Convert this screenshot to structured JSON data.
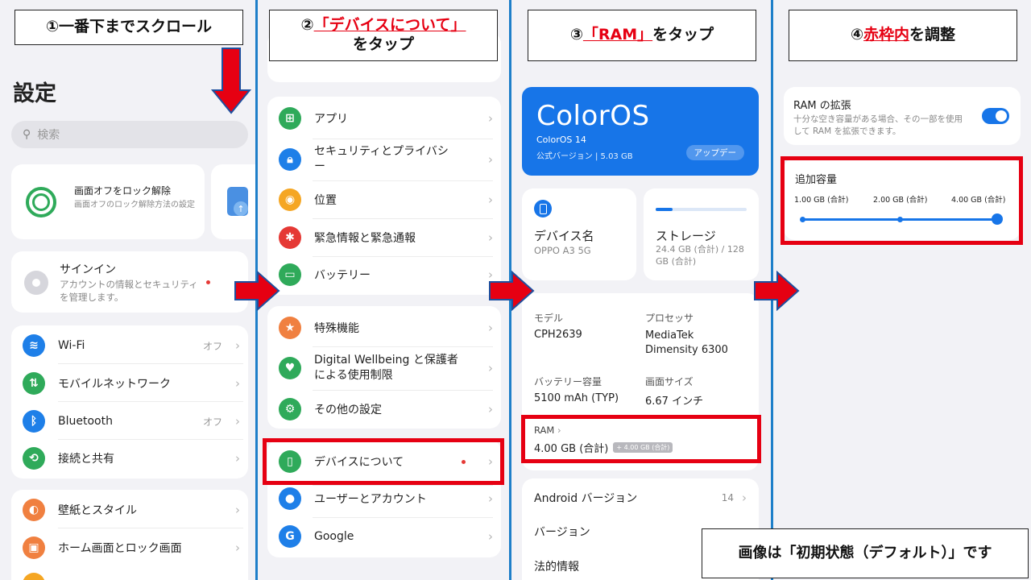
{
  "colors": {
    "red": "#e60012",
    "blue": "#1e7fc9",
    "oppo_blue": "#1775e8"
  },
  "callouts": {
    "step1": "①一番下までスクロール",
    "step2_num": "②",
    "step2_red": "「デバイスについて」",
    "step2_suffix": "をタップ",
    "step3_num": "③",
    "step3_red": "「RAM」",
    "step3_suffix": "をタップ",
    "step4_num": "④",
    "step4_red": "赤枠内",
    "step4_suffix": "を調整",
    "note": "画像は「初期状態（デフォルト）」です"
  },
  "panel1": {
    "title": "設定",
    "search_placeholder": "検索",
    "unlock_title": "画面オフをロック解除",
    "unlock_desc": "画面オフのロック解除方法の設定",
    "signin_title": "サインイン",
    "signin_desc": "アカウントの情報とセキュリティを管理します。",
    "items": [
      {
        "label": "Wi-Fi",
        "value": "オフ",
        "icon": "wifi-icon",
        "color": "#1e7fe8"
      },
      {
        "label": "モバイルネットワーク",
        "value": "",
        "icon": "mobile-network-icon",
        "color": "#2faa5a"
      },
      {
        "label": "Bluetooth",
        "value": "オフ",
        "icon": "bluetooth-icon",
        "color": "#1e7fe8"
      },
      {
        "label": "接続と共有",
        "value": "",
        "icon": "share-icon",
        "color": "#2faa5a"
      }
    ],
    "items2": [
      {
        "label": "壁紙とスタイル",
        "icon": "wallpaper-icon",
        "color": "#f08040"
      },
      {
        "label": "ホーム画面とロック画面",
        "icon": "home-screen-icon",
        "color": "#f08040"
      }
    ]
  },
  "panel2": {
    "items": [
      {
        "label": "アプリ",
        "icon": "apps-icon",
        "color": "#2faa5a"
      },
      {
        "label": "セキュリティとプライバシー",
        "icon": "security-icon",
        "color": "#1e7fe8"
      },
      {
        "label": "位置",
        "icon": "location-icon",
        "color": "#f5a623"
      },
      {
        "label": "緊急情報と緊急通報",
        "icon": "emergency-icon",
        "color": "#e53935"
      },
      {
        "label": "バッテリー",
        "icon": "battery-icon",
        "color": "#2faa5a"
      }
    ],
    "items2": [
      {
        "label": "特殊機能",
        "icon": "special-features-icon",
        "color": "#f08040"
      },
      {
        "label": "Digital Wellbeing と保護者による使用制限",
        "icon": "wellbeing-icon",
        "color": "#2faa5a"
      },
      {
        "label": "その他の設定",
        "icon": "other-settings-icon",
        "color": "#2faa5a"
      }
    ],
    "items3": [
      {
        "label": "デバイスについて",
        "icon": "device-icon",
        "color": "#2faa5a"
      },
      {
        "label": "ユーザーとアカウント",
        "icon": "user-icon",
        "color": "#1e7fe8"
      },
      {
        "label": "Google",
        "icon": "google-icon",
        "color": "#1e7fe8"
      }
    ]
  },
  "panel3": {
    "os_logo": "ColorOS",
    "os_version": "ColorOS 14",
    "os_official": "公式バージョン | 5.03 GB",
    "update_btn": "アップデー",
    "device_name_label": "デバイス名",
    "device_name_value": "OPPO A3 5G",
    "storage_label": "ストレージ",
    "storage_value": "24.4 GB (合計) / 128 GB (合計)",
    "storage_used_fraction": 0.19,
    "model_label": "モデル",
    "model_value": "CPH2639",
    "cpu_label": "プロセッサ",
    "cpu_value": "MediaTek Dimensity 6300",
    "battery_label": "バッテリー容量",
    "battery_value": "5100 mAh (TYP)",
    "screen_label": "画面サイズ",
    "screen_value": "6.67 インチ",
    "ram_label": "RAM",
    "ram_value": "4.00 GB (合計)",
    "ram_badge": "+ 4.00 GB (合計)",
    "android_label": "Android バージョン",
    "android_value": "14",
    "version_label": "バージョン",
    "legal_label": "法的情報"
  },
  "panel4": {
    "ram_ext_title": "RAM の拡張",
    "ram_ext_desc": "十分な空き容量がある場合、その一部を使用して RAM を拡張できます。",
    "toggle_on": true,
    "extra_title": "追加容量",
    "options": [
      "1.00 GB (合計)",
      "2.00 GB (合計)",
      "4.00 GB (合計)"
    ],
    "selected_index": 2
  }
}
